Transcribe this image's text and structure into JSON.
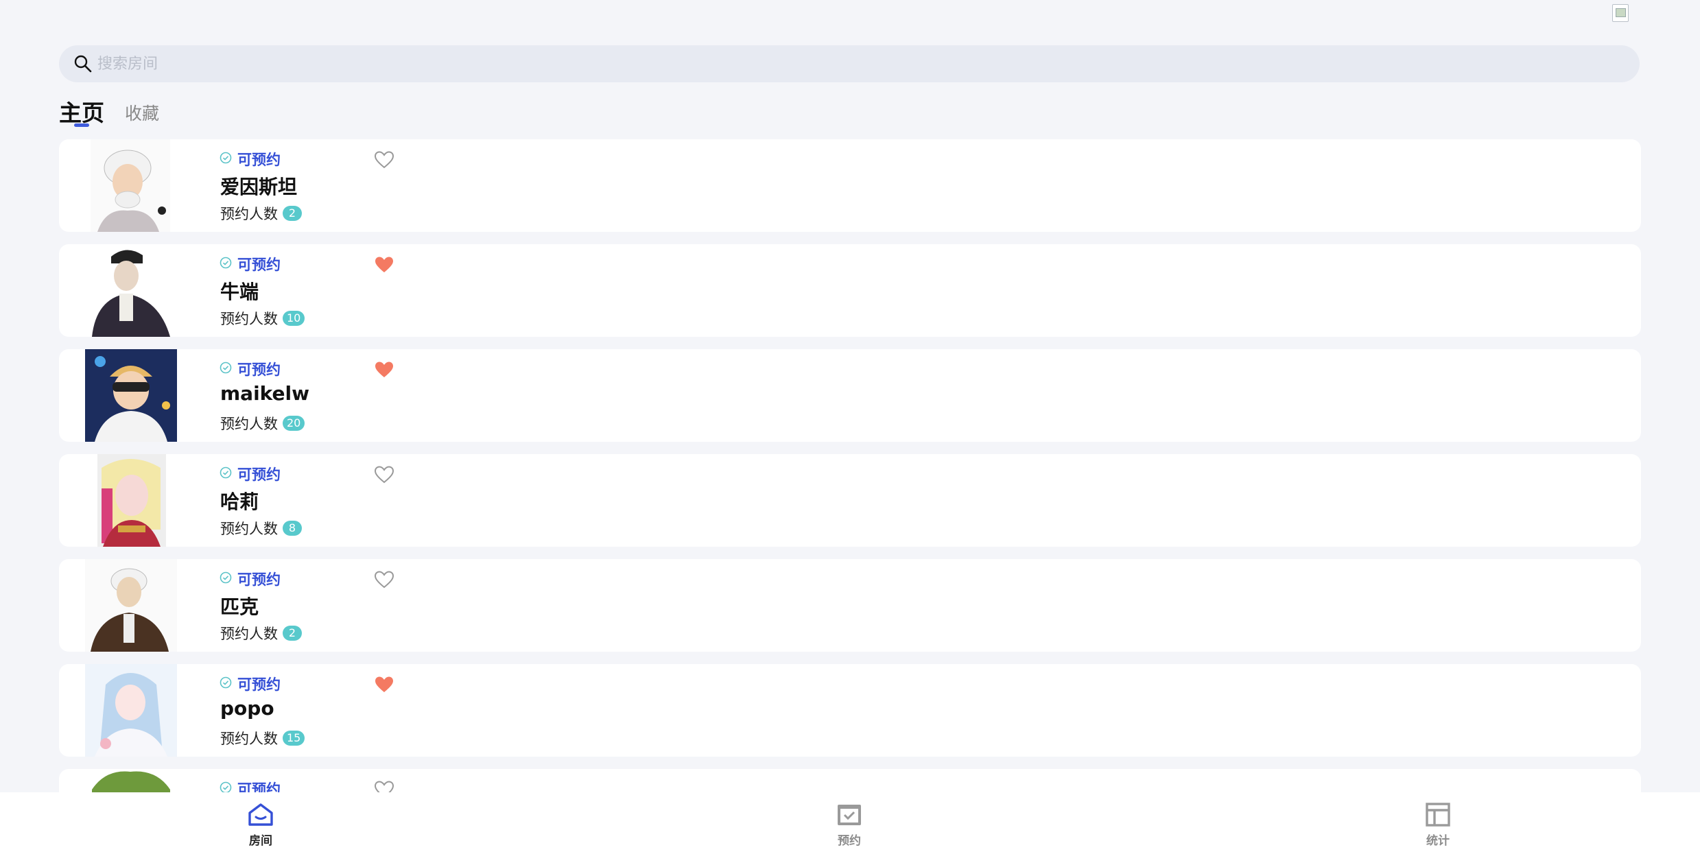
{
  "header": {
    "avatar_icon": "broken-image-icon"
  },
  "search": {
    "placeholder": "搜索房间",
    "value": ""
  },
  "tabs": [
    {
      "label": "主页",
      "active": true
    },
    {
      "label": "收藏",
      "active": false
    }
  ],
  "rooms": [
    {
      "status": "可预约",
      "name": "爱因斯坦",
      "count_label": "预约人数",
      "count": "2",
      "favorited": false
    },
    {
      "status": "可预约",
      "name": "牛端",
      "count_label": "预约人数",
      "count": "10",
      "favorited": true
    },
    {
      "status": "可预约",
      "name": "maikelw",
      "count_label": "预约人数",
      "count": "20",
      "favorited": true
    },
    {
      "status": "可预约",
      "name": "哈莉",
      "count_label": "预约人数",
      "count": "8",
      "favorited": false
    },
    {
      "status": "可预约",
      "name": "匹克",
      "count_label": "预约人数",
      "count": "2",
      "favorited": false
    },
    {
      "status": "可预约",
      "name": "popo",
      "count_label": "预约人数",
      "count": "15",
      "favorited": true
    },
    {
      "status": "可预约",
      "name": "",
      "count_label": "",
      "count": "",
      "favorited": false
    }
  ],
  "bottom_nav": [
    {
      "label": "房间",
      "icon": "home-icon",
      "active": true
    },
    {
      "label": "预约",
      "icon": "calendar-check-icon",
      "active": false
    },
    {
      "label": "统计",
      "icon": "layout-icon",
      "active": false
    }
  ],
  "colors": {
    "accent": "#3550d6",
    "favorite": "#f47a62",
    "badge": "#58c9cc",
    "background": "#f4f5f9"
  }
}
